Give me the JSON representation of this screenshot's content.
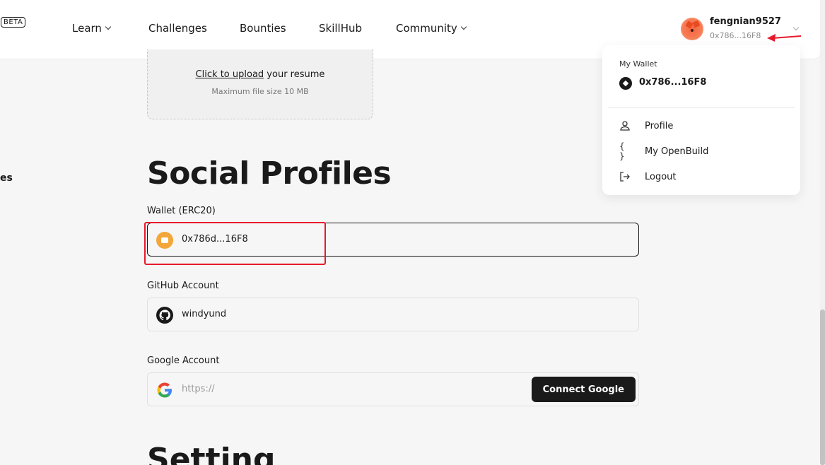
{
  "header": {
    "beta_label": "BETA",
    "nav": [
      {
        "label": "Learn",
        "dropdown": true
      },
      {
        "label": "Challenges",
        "dropdown": false
      },
      {
        "label": "Bounties",
        "dropdown": false
      },
      {
        "label": "SkillHub",
        "dropdown": false
      },
      {
        "label": "Community",
        "dropdown": true
      }
    ],
    "user": {
      "name": "fengnian9527",
      "address": "0x786...16F8"
    }
  },
  "upload": {
    "link_text": "Click to upload",
    "rest_text": " your resume",
    "max_size": "Maximum file size 10 MB"
  },
  "sidebar": {
    "partial_text": "es"
  },
  "social": {
    "title": "Social Profiles",
    "wallet": {
      "label": "Wallet (ERC20)",
      "value": "0x786d...16F8"
    },
    "github": {
      "label": "GitHub Account",
      "value": "windyund"
    },
    "google": {
      "label": "Google Account",
      "placeholder": "https://",
      "button": "Connect Google"
    }
  },
  "setting": {
    "title": "Setting"
  },
  "dropdown": {
    "title": "My Wallet",
    "address": "0x786...16F8",
    "items": [
      {
        "label": "Profile",
        "icon": "person-icon"
      },
      {
        "label": "My OpenBuild",
        "icon": "braces-icon",
        "glyph": "{ }"
      },
      {
        "label": "Logout",
        "icon": "logout-icon"
      }
    ]
  },
  "colors": {
    "accent_red": "#e8192c",
    "wallet_orange": "#f3a63a",
    "button_dark": "#1a1a1a"
  }
}
